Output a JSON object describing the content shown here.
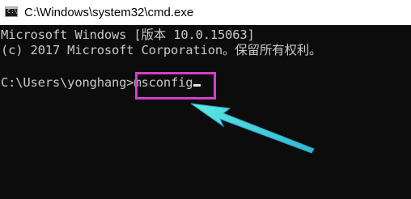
{
  "window": {
    "title": "C:\\Windows\\system32\\cmd.exe",
    "icon": "cmd-icon"
  },
  "console": {
    "lines": [
      "Microsoft Windows [版本 10.0.15063]",
      "(c) 2017 Microsoft Corporation。保留所有权利。",
      "",
      "C:\\Users\\yonghang>"
    ],
    "typed_command": "msconfig",
    "colors": {
      "background": "#0c0c0c",
      "text": "#c8c8c8"
    }
  },
  "annotation": {
    "box_color": "#d63cd0",
    "arrow_color": "#3fd6d6",
    "arrow_icon": "arrow-pointer-icon"
  }
}
